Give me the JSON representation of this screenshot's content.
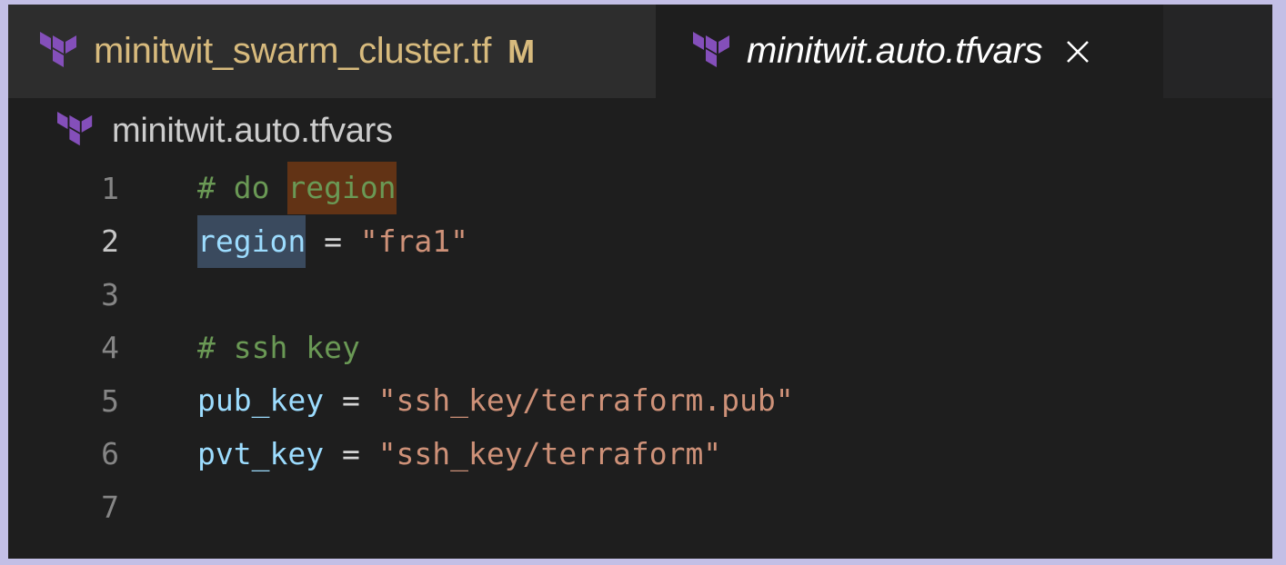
{
  "tabs": [
    {
      "label": "minitwit_swarm_cluster.tf",
      "badge": "M",
      "icon": "terraform-icon",
      "active": false
    },
    {
      "label": "minitwit.auto.tfvars",
      "icon": "terraform-icon",
      "active": true,
      "close_icon": "close-icon"
    }
  ],
  "breadcrumb": {
    "label": "minitwit.auto.tfvars",
    "icon": "terraform-icon"
  },
  "editor": {
    "active_line": 2,
    "lines": [
      {
        "num": "1",
        "tokens": {
          "a": "# do ",
          "b": "region"
        }
      },
      {
        "num": "2",
        "tokens": {
          "a": "region",
          "b": " = ",
          "c": "\"fra1\""
        }
      },
      {
        "num": "3"
      },
      {
        "num": "4",
        "tokens": {
          "a": "# ssh key"
        }
      },
      {
        "num": "5",
        "tokens": {
          "a": "pub_key",
          "b": " = ",
          "c": "\"ssh_key/terraform.pub\""
        }
      },
      {
        "num": "6",
        "tokens": {
          "a": "pvt_key",
          "b": " = ",
          "c": "\"ssh_key/terraform\""
        }
      },
      {
        "num": "7"
      }
    ]
  },
  "colors": {
    "terraform_purple": "#844fba",
    "modified": "#d7ba7d",
    "comment": "#6a9955",
    "variable": "#9cdcfe",
    "string": "#ce9178",
    "find_highlight": "#623315",
    "selection": "#3a4a5e"
  }
}
